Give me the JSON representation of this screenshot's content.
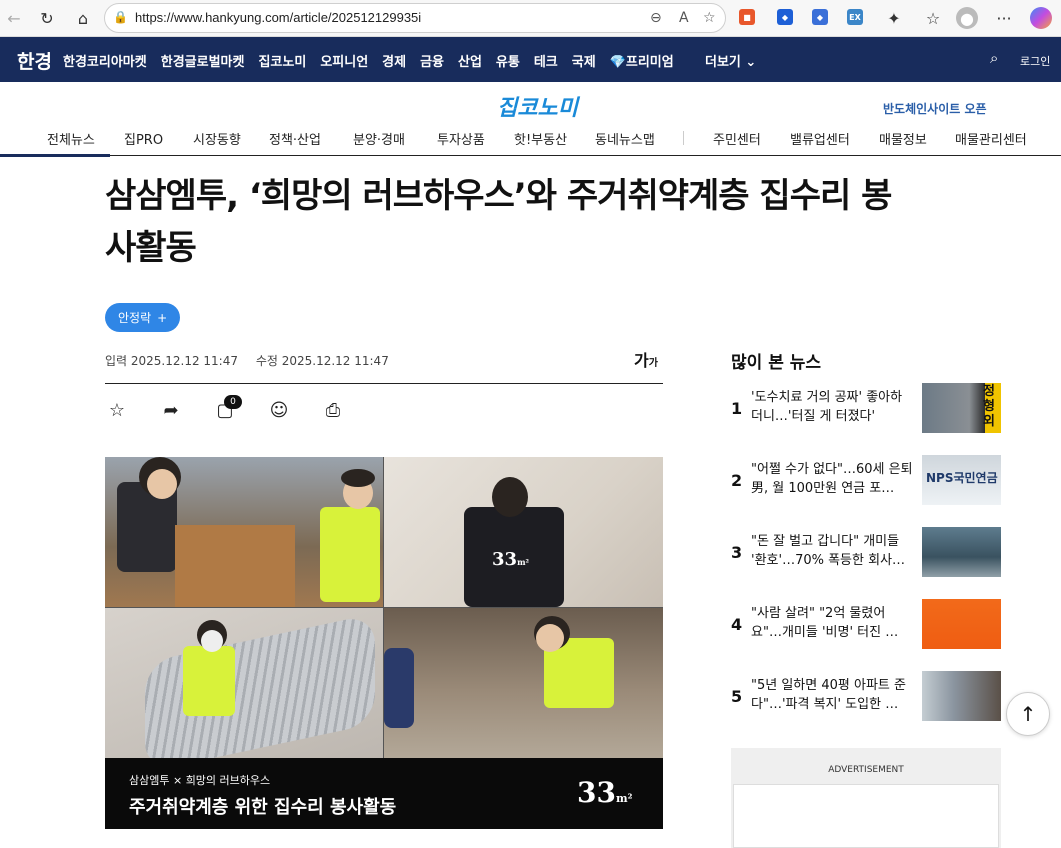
{
  "browser": {
    "url": "https://www.hankyung.com/article/202512129935i"
  },
  "topnav": {
    "logo": "한경",
    "items": [
      "한경코리아마켓",
      "한경글로벌마켓",
      "집코노미",
      "오피니언",
      "경제",
      "금융",
      "산업",
      "유통",
      "테크",
      "국제",
      "💎프리미엄"
    ],
    "more": "더보기",
    "login": "로그인"
  },
  "section": {
    "brand": "집코노미",
    "promo": "반도체인사이트 오픈",
    "subnav": [
      "전체뉴스",
      "집PRO",
      "시장동향",
      "정책·산업",
      "분양·경매",
      "투자상품",
      "핫!부동산",
      "동네뉴스맵",
      "주민센터",
      "밸류업센터",
      "매물정보",
      "매물관리센터"
    ]
  },
  "article": {
    "title": "삼삼엠투, ‘희망의 러브하우스’와 주거취약계층 집수리 봉사활동",
    "author": "안정락",
    "author_plus": "+",
    "input_date": "입력 2025.12.12 11:47",
    "modified_date": "수정 2025.12.12 11:47",
    "font_size_label": "가",
    "font_size_small": "가",
    "comment_count": "0",
    "photo": {
      "caption_small": "삼삼엠투 × 희망의 러브하우스",
      "caption_big": "주거취약계층 위한 집수리 봉사활동",
      "logo": "33",
      "logo_unit": "m²",
      "panel_logo": "33",
      "panel_logo_unit": "m²"
    }
  },
  "sidebar": {
    "title": "많이 본 뉴스",
    "items": [
      {
        "rank": "1",
        "text": "'도수치료 거의 공짜' 좋아하더니…'터질 게 터졌다'"
      },
      {
        "rank": "2",
        "text": "\"어쩔 수가 없다\"…60세 은퇴男, 월 100만원 연금 포…"
      },
      {
        "rank": "3",
        "text": "\"돈 잘 벌고 갑니다\" 개미들 '환호'…70% 폭등한 회사…"
      },
      {
        "rank": "4",
        "text": "\"사람 살려\" \"2억 물렸어요\"…개미들 '비명' 터진 …"
      },
      {
        "rank": "5",
        "text": "\"5년 일하면 40평 아파트 준다\"…'파격 복지' 도입한 …"
      }
    ],
    "thumb1_text": "정형외",
    "thumb2_text": "NPS국민연금",
    "ad_label": "ADVERTISEMENT"
  },
  "colors": {
    "nav_bg": "#182c5c",
    "author_bg": "#2f86e6",
    "brand": "#1a8ad8"
  }
}
